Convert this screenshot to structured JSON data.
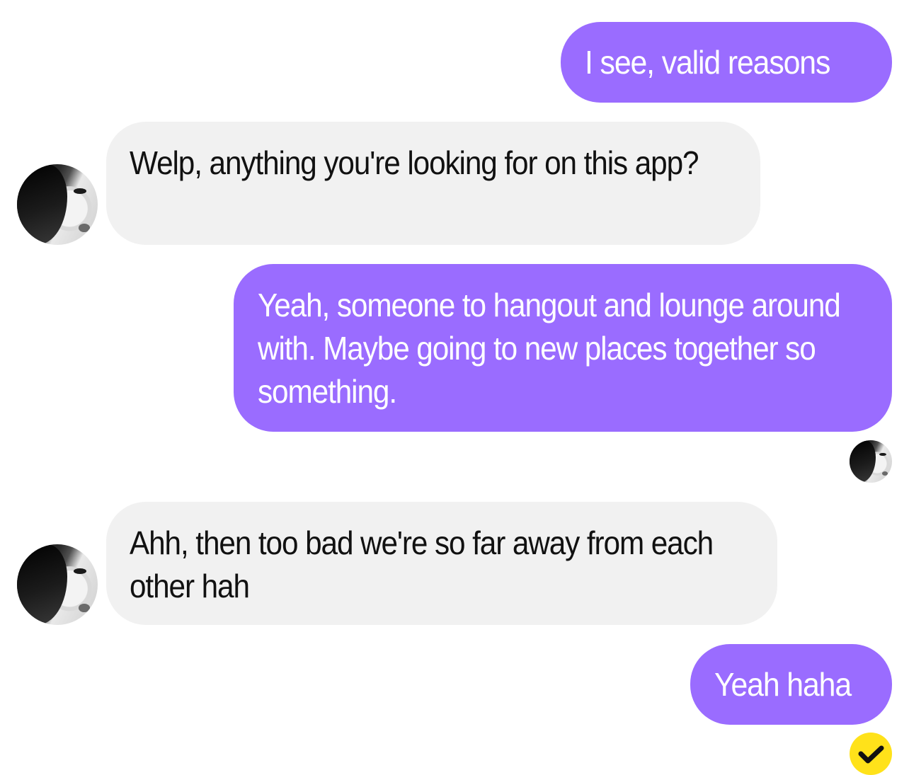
{
  "conversation": {
    "messages": [
      {
        "side": "sent",
        "text": "I see, valid reasons"
      },
      {
        "side": "received",
        "text": "Welp, anything you're looking for on this app?"
      },
      {
        "side": "sent",
        "text": "Yeah, someone to hangout and lounge around with. Maybe going to new places together so something."
      },
      {
        "side": "received",
        "text": "Ahh, then too bad we're so far away from each other hah"
      },
      {
        "side": "sent",
        "text": "Yeah haha"
      }
    ],
    "status_icon": "checkmark-icon"
  },
  "colors": {
    "sent_bubble": "#9a6cff",
    "received_bubble": "#f1f1f1",
    "read_badge": "#ffe21a"
  }
}
